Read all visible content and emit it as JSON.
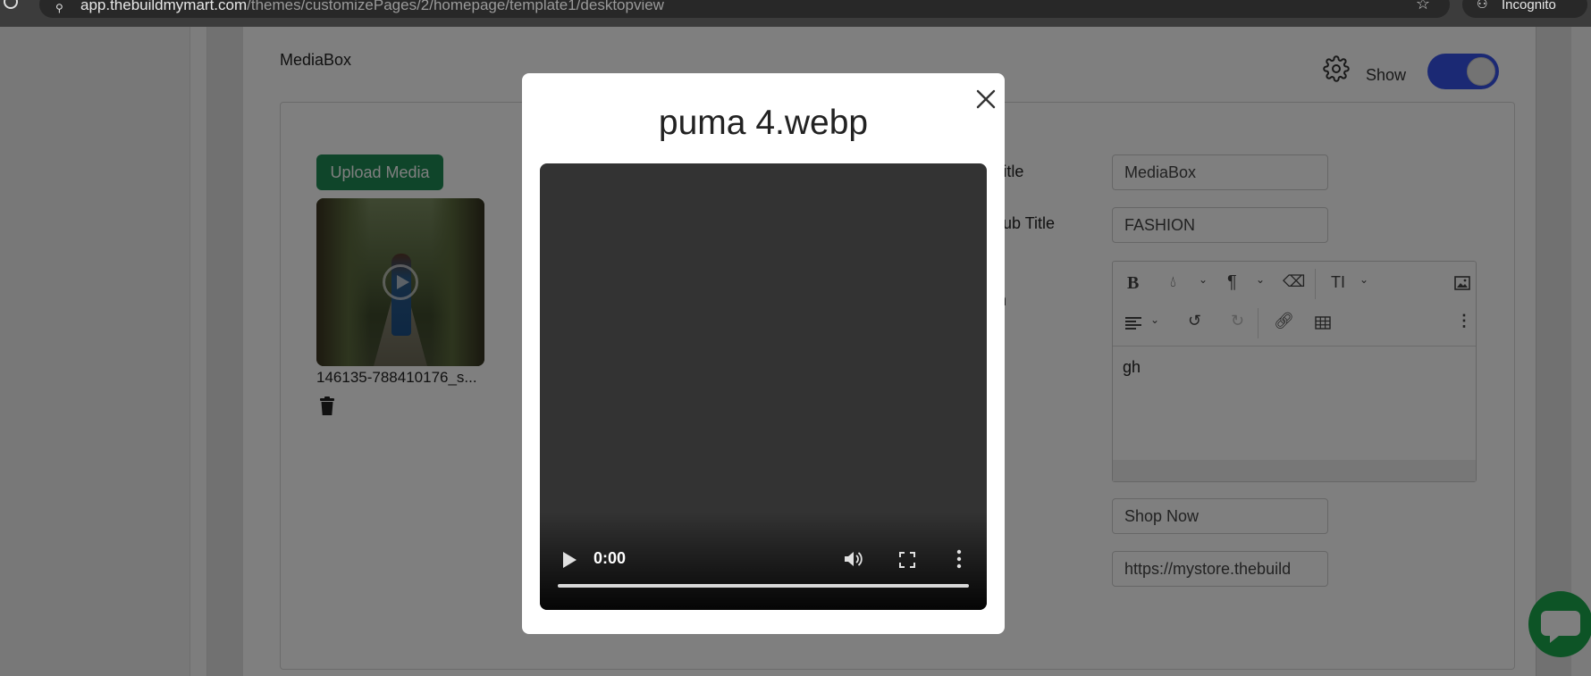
{
  "browser": {
    "url_host": "app.thebuildmymart.com",
    "url_path": "/themes/customizePages/2/homepage/template1/desktopview",
    "incognito_label": "Incognito"
  },
  "section": {
    "title": "MediaBox",
    "show_label": "Show",
    "show_enabled": true
  },
  "media": {
    "upload_label": "Upload Media",
    "file_name": "146135-788410176_s..."
  },
  "form": {
    "title_label": "Title",
    "title_value": "MediaBox",
    "subtitle_label": "Sub Title",
    "subtitle_value": "FASHION",
    "description_label": "n",
    "editor_content": "gh",
    "button_text_value": "Shop Now",
    "button_link_value": "https://mystore.thebuild"
  },
  "editor_toolbar": {
    "bold": "B",
    "paragraph": "¶",
    "text_size": "TI"
  },
  "modal": {
    "title": "puma 4.webp",
    "video_time": "0:00",
    "video_progress": 0
  },
  "colors": {
    "primary_green": "#1f8a55",
    "toggle_blue": "#3652e8",
    "chat_green": "#1aa84c"
  }
}
